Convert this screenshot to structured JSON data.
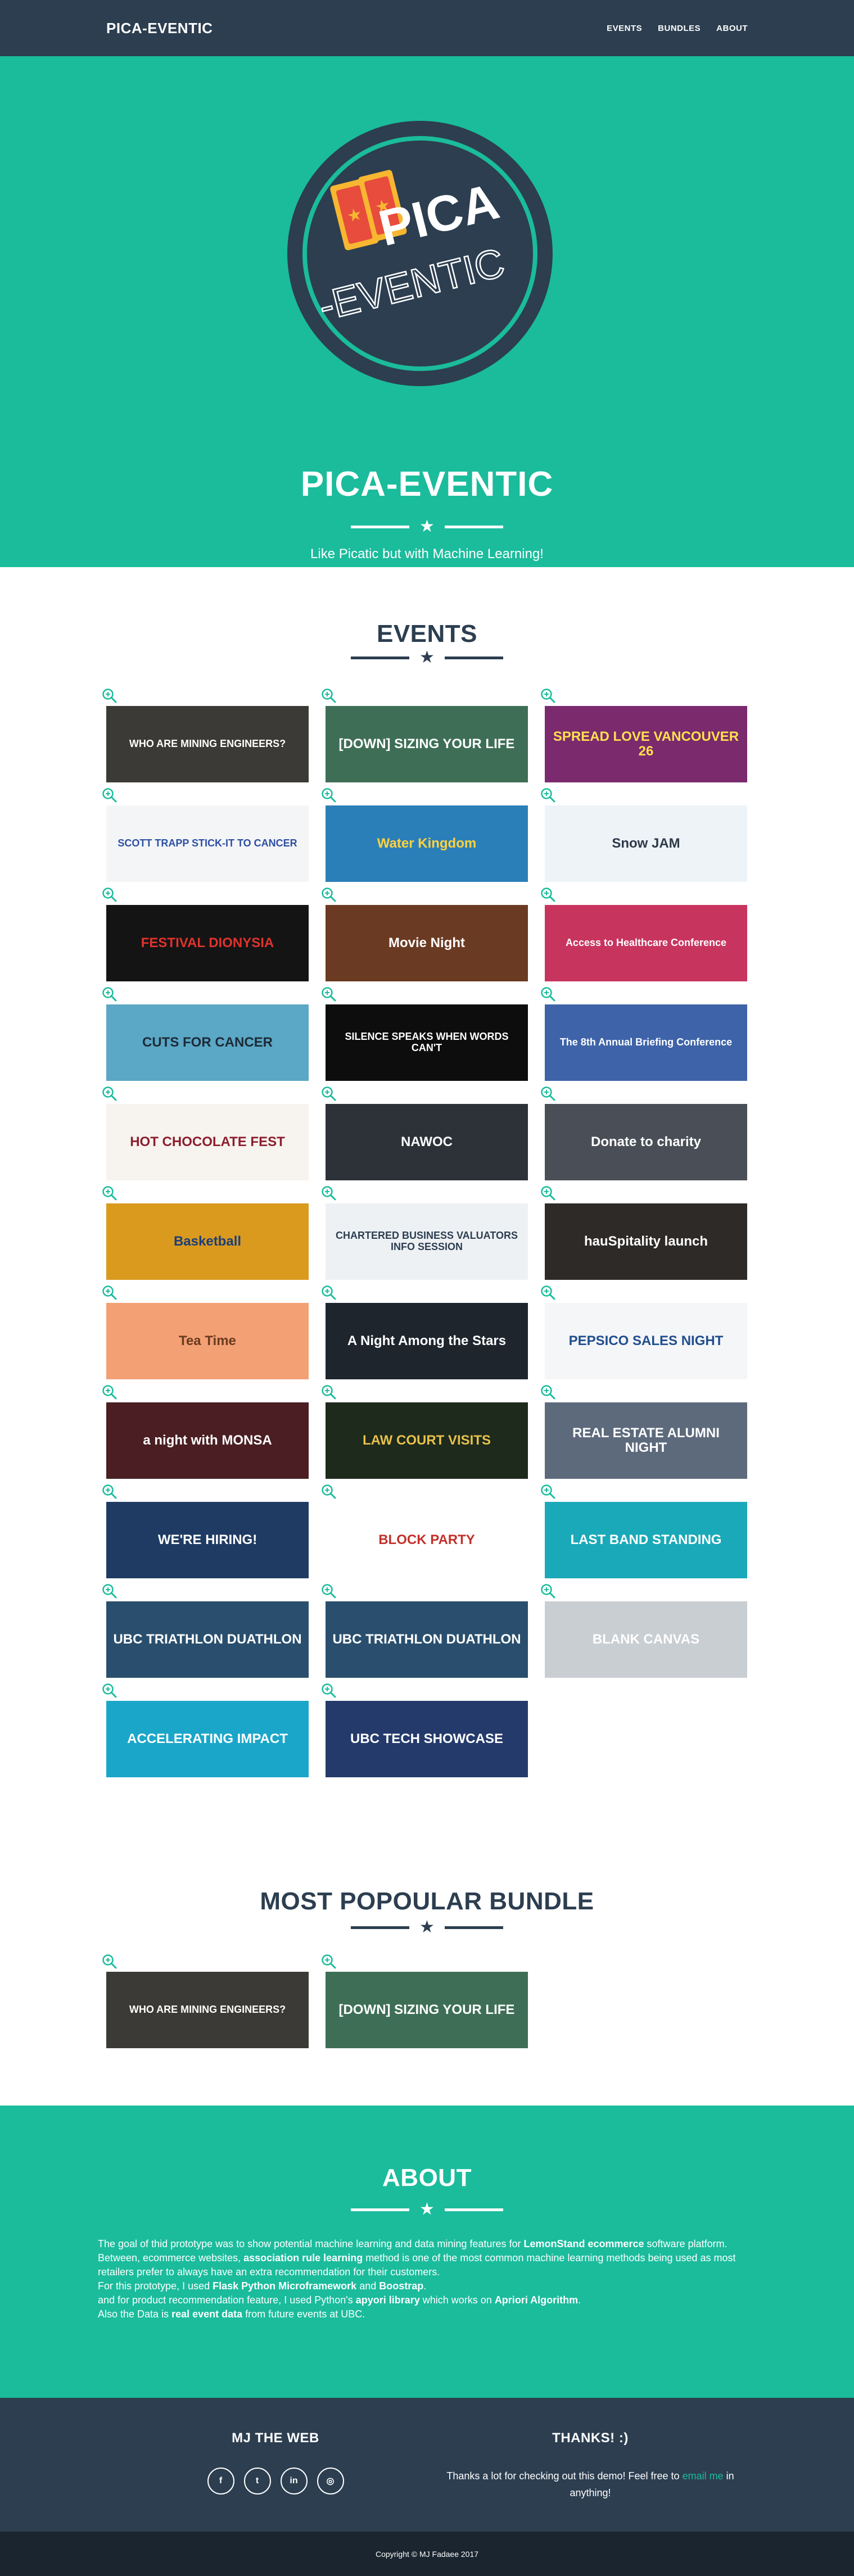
{
  "nav": {
    "brand": "PICA-EVENTIC",
    "links": [
      "EVENTS",
      "BUNDLES",
      "ABOUT"
    ]
  },
  "header": {
    "logo_text_1": "PICA",
    "logo_text_2": "-EVENTIC",
    "title": "PICA-EVENTIC",
    "subtitle": "Like Picatic but with Machine Learning!"
  },
  "events": {
    "title": "EVENTS",
    "cards": [
      {
        "label": "WHO ARE MINING ENGINEERS?",
        "bg": "#3b3a36",
        "fg": "#ffffff"
      },
      {
        "label": "[DOWN] SIZING YOUR LIFE",
        "bg": "#3e6f56",
        "fg": "#ffffff"
      },
      {
        "label": "SPREAD LOVE VANCOUVER 26",
        "bg": "#7b2a6e",
        "fg": "#ffe14d"
      },
      {
        "label": "SCOTT TRAPP STICK-IT TO CANCER",
        "bg": "#f4f5f7",
        "fg": "#2d4fa3"
      },
      {
        "label": "Water Kingdom",
        "bg": "#2b7fb8",
        "fg": "#ffd23f"
      },
      {
        "label": "Snow JAM",
        "bg": "#eef3f7",
        "fg": "#2e3a4a"
      },
      {
        "label": "FESTIVAL DIONYSIA",
        "bg": "#141414",
        "fg": "#e0332e"
      },
      {
        "label": "Movie Night",
        "bg": "#6b3a22",
        "fg": "#ffffff"
      },
      {
        "label": "Access to Healthcare Conference",
        "bg": "#c7355f",
        "fg": "#ffffff"
      },
      {
        "label": "CUTS FOR CANCER",
        "bg": "#5aa7c6",
        "fg": "#1e2a36"
      },
      {
        "label": "SILENCE SPEAKS WHEN WORDS CAN'T",
        "bg": "#0d0d0d",
        "fg": "#ffffff"
      },
      {
        "label": "The 8th Annual Briefing Conference",
        "bg": "#3e63a9",
        "fg": "#ffffff"
      },
      {
        "label": "HOT CHOCOLATE FEST",
        "bg": "#f7f3ef",
        "fg": "#8b1e2d"
      },
      {
        "label": "NAWOC",
        "bg": "#2c3238",
        "fg": "#ffffff"
      },
      {
        "label": "Donate to charity",
        "bg": "#4a4f57",
        "fg": "#ffffff"
      },
      {
        "label": "Basketball",
        "bg": "#d99a1e",
        "fg": "#1d3e7a"
      },
      {
        "label": "CHARTERED BUSINESS VALUATORS INFO SESSION",
        "bg": "#eef1f4",
        "fg": "#2c3e50"
      },
      {
        "label": "hauSpitality launch",
        "bg": "#2d2a28",
        "fg": "#ffffff"
      },
      {
        "label": "Tea Time",
        "bg": "#f2a074",
        "fg": "#6b3b1f"
      },
      {
        "label": "A Night Among the Stars",
        "bg": "#1e252d",
        "fg": "#ffffff"
      },
      {
        "label": "PEPSICO SALES NIGHT",
        "bg": "#f5f6f8",
        "fg": "#1f4e8c"
      },
      {
        "label": "a night with MONSA",
        "bg": "#4a1e22",
        "fg": "#ffffff"
      },
      {
        "label": "LAW COURT VISITS",
        "bg": "#1d2a1c",
        "fg": "#e8c04d"
      },
      {
        "label": "REAL ESTATE ALUMNI NIGHT",
        "bg": "#5d6a7c",
        "fg": "#ffffff"
      },
      {
        "label": "WE'RE HIRING!",
        "bg": "#1f3b63",
        "fg": "#ffffff"
      },
      {
        "label": "BLOCK PARTY",
        "bg": "#ffffff",
        "fg": "#c4302b"
      },
      {
        "label": "LAST BAND STANDING",
        "bg": "#1aa9b8",
        "fg": "#ffffff"
      },
      {
        "label": "UBC TRIATHLON DUATHLON",
        "bg": "#2a4f6e",
        "fg": "#ffffff"
      },
      {
        "label": "UBC TRIATHLON DUATHLON",
        "bg": "#2a4f6e",
        "fg": "#ffffff"
      },
      {
        "label": "BLANK CANVAS",
        "bg": "#c9ced3",
        "fg": "#ffffff"
      },
      {
        "label": "ACCELERATING IMPACT",
        "bg": "#1aa6c9",
        "fg": "#ffffff"
      },
      {
        "label": "UBC TECH SHOWCASE",
        "bg": "#243a6b",
        "fg": "#ffffff"
      }
    ]
  },
  "bundle": {
    "title": "MOST POPOULAR BUNDLE",
    "cards": [
      {
        "label": "WHO ARE MINING ENGINEERS?",
        "bg": "#3b3a36",
        "fg": "#ffffff"
      },
      {
        "label": "[DOWN] SIZING YOUR LIFE",
        "bg": "#3e6f56",
        "fg": "#ffffff"
      }
    ]
  },
  "about": {
    "title": "ABOUT",
    "p1a": "The goal of thid prototype was to show potential machine learning and data mining features for ",
    "p1b": "LemonStand ecommerce",
    "p1c": " software platform.",
    "p2a": "Between, ecommerce websites, ",
    "p2b": "association rule learning",
    "p2c": " method is one of the most common machine learning methods being used as most retailers prefer to always have an extra recommendation for their customers.",
    "p3a": "For this prototype, I used ",
    "p3b": "Flask Python Microframework",
    "p3c": " and ",
    "p3d": "Boostrap",
    "p3e": ".",
    "p4a": "and for product recommendation feature, I used Python's ",
    "p4b": "apyori library",
    "p4c": " which works on ",
    "p4d": "Apriori Algorithm",
    "p4e": ".",
    "p5a": "Also the Data is ",
    "p5b": "real event data",
    "p5c": " from future events at UBC."
  },
  "footer": {
    "col1_title": "MJ THE WEB",
    "socials": [
      "f",
      "t",
      "in",
      "◎"
    ],
    "col2_title": "THANKS! :)",
    "thanks_a": "Thanks a lot for checking out this demo! Feel free to ",
    "thanks_link": "email me",
    "thanks_b": " in anything!",
    "copyright": "Copyright © MJ Fadaee 2017"
  },
  "colors": {
    "primary": "#2c3e50",
    "accent": "#1abc9c"
  }
}
